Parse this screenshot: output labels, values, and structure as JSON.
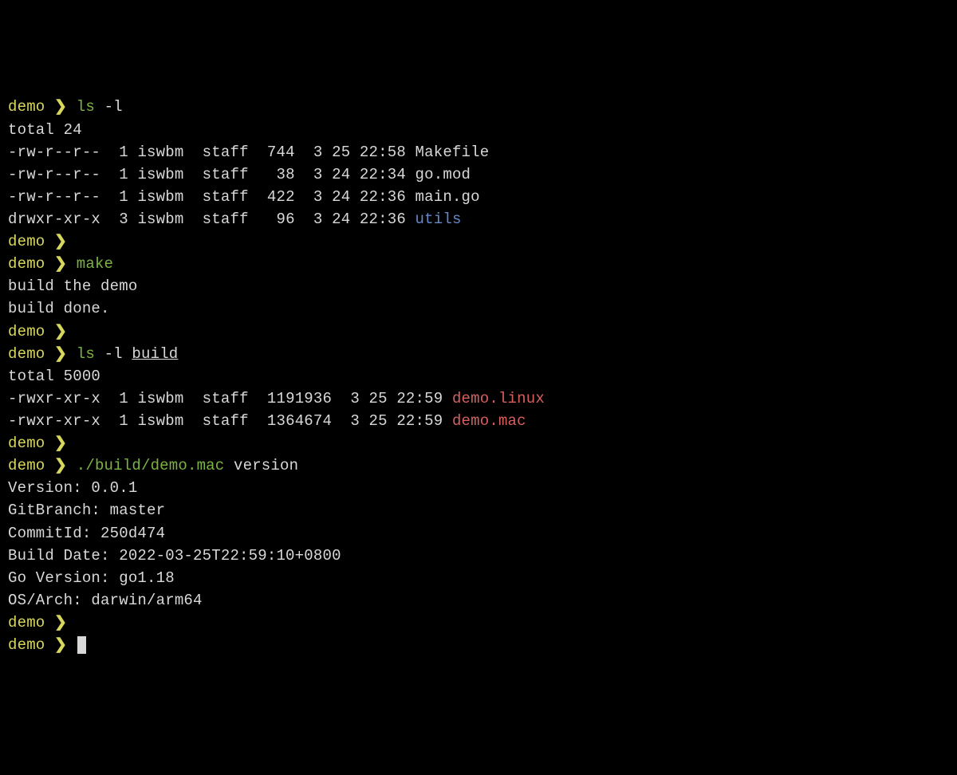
{
  "prompt_name": "demo",
  "arrow": "❯",
  "cmd1": {
    "cmd": "ls",
    "arg": " -l"
  },
  "ls1": {
    "total": "total 24",
    "rows": [
      {
        "perm": "-rw-r--r--",
        "lnk": "  1",
        "user": " iswbm",
        "group": "  staff",
        "size": "  744",
        "date": "  3 25 22:58 ",
        "name": "Makefile",
        "cls": "white"
      },
      {
        "perm": "-rw-r--r--",
        "lnk": "  1",
        "user": " iswbm",
        "group": "  staff",
        "size": "   38",
        "date": "  3 24 22:34 ",
        "name": "go.mod",
        "cls": "white"
      },
      {
        "perm": "-rw-r--r--",
        "lnk": "  1",
        "user": " iswbm",
        "group": "  staff",
        "size": "  422",
        "date": "  3 24 22:36 ",
        "name": "main.go",
        "cls": "white"
      },
      {
        "perm": "drwxr-xr-x",
        "lnk": "  3",
        "user": " iswbm",
        "group": "  staff",
        "size": "   96",
        "date": "  3 24 22:36 ",
        "name": "utils",
        "cls": "blue"
      }
    ]
  },
  "cmd2": {
    "cmd": "make"
  },
  "make_output": [
    "build the demo",
    "build done."
  ],
  "cmd3": {
    "cmd": "ls",
    "arg": " -l ",
    "argdir": "build"
  },
  "ls2": {
    "total": "total 5000",
    "rows": [
      {
        "perm": "-rwxr-xr-x",
        "lnk": "  1",
        "user": " iswbm",
        "group": "  staff",
        "size": "  1191936",
        "date": "  3 25 22:59 ",
        "name": "demo.linux",
        "cls": "red"
      },
      {
        "perm": "-rwxr-xr-x",
        "lnk": "  1",
        "user": " iswbm",
        "group": "  staff",
        "size": "  1364674",
        "date": "  3 25 22:59 ",
        "name": "demo.mac",
        "cls": "red"
      }
    ]
  },
  "cmd4": {
    "cmd": "./build/demo.mac",
    "arg": " version"
  },
  "version_output": [
    "Version: 0.0.1",
    "GitBranch: master",
    "CommitId: 250d474",
    "Build Date: 2022-03-25T22:59:10+0800",
    "Go Version: go1.18",
    "OS/Arch: darwin/arm64"
  ]
}
